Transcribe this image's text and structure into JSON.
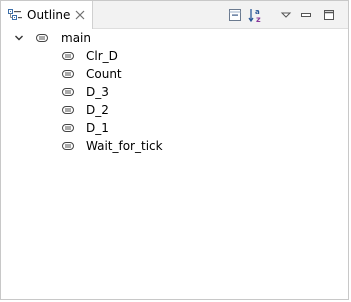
{
  "tab": {
    "label": "Outline",
    "icon": "outline-icon",
    "close_icon": "close-icon"
  },
  "toolbar": {
    "collapse_all_icon": "collapse-all-icon",
    "sort_icon": "sort-az-icon",
    "view_menu_icon": "view-menu-icon",
    "minimize_icon": "minimize-icon",
    "maximize_icon": "maximize-icon"
  },
  "tree": {
    "root": {
      "label": "main",
      "expanded": true,
      "expander_icon": "chevron-down-icon",
      "icon": "function-icon"
    },
    "children": [
      {
        "label": "Clr_D",
        "icon": "label-icon"
      },
      {
        "label": "Count",
        "icon": "label-icon"
      },
      {
        "label": "D_3",
        "icon": "label-icon"
      },
      {
        "label": "D_2",
        "icon": "label-icon"
      },
      {
        "label": "D_1",
        "icon": "label-icon"
      },
      {
        "label": "Wait_for_tick",
        "icon": "label-icon"
      }
    ]
  },
  "colors": {
    "tab_background": "#ffffff",
    "titlebar_background": "#f2f2f2",
    "border": "#c8c8c8",
    "sort_icon_accent": "#8a3a9c",
    "sort_icon_blue": "#2b5797"
  }
}
